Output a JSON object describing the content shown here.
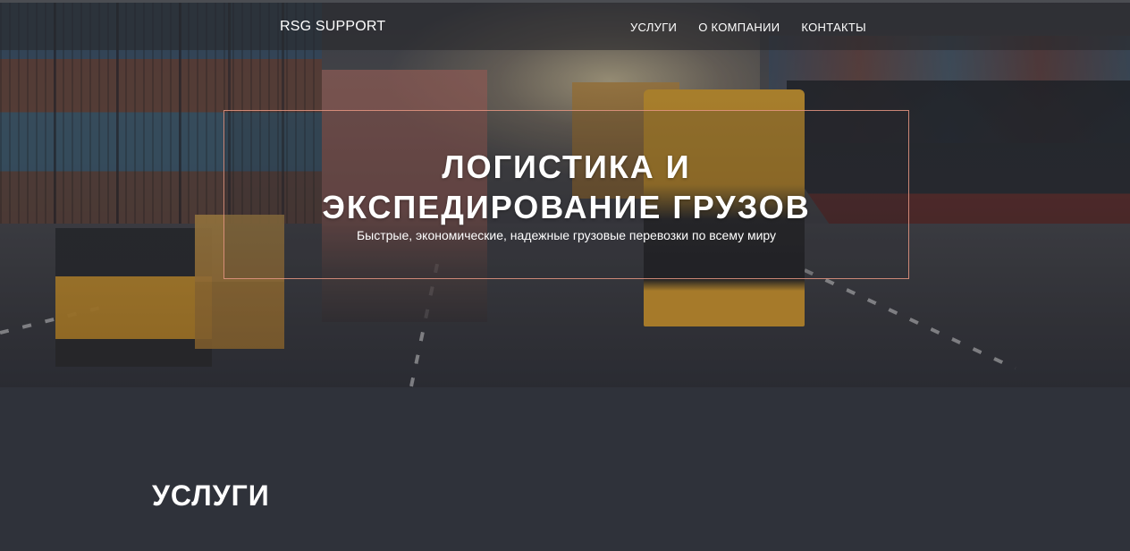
{
  "nav": {
    "brand": "RSG SUPPORT",
    "links": [
      {
        "label": "УСЛУГИ"
      },
      {
        "label": "О КОМПАНИИ"
      },
      {
        "label": "КОНТАКТЫ"
      }
    ]
  },
  "hero": {
    "title_line1": "ЛОГИСТИКА И",
    "title_line2": "ЭКСПЕДИРОВАНИЕ ГРУЗОВ",
    "subtitle": "Быстрые, экономические, надежные грузовые перевозки по всему миру",
    "image": "logistics-trucks-port-photo",
    "box_border_color": "#e89682"
  },
  "services": {
    "title": "УСЛУГИ",
    "background": "#2f323a"
  }
}
